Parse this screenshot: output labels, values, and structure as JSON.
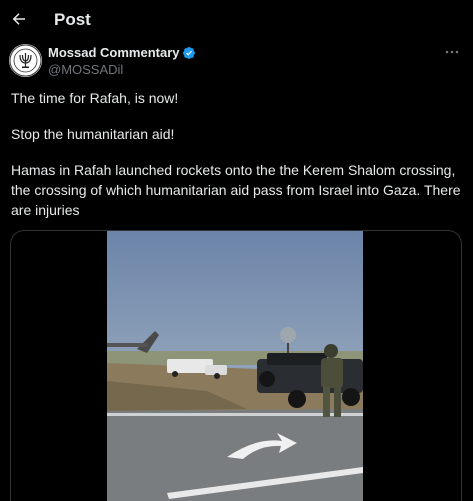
{
  "header": {
    "back_icon": "arrow-left-icon",
    "title": "Post"
  },
  "author": {
    "name": "Mossad Commentary",
    "handle": "@MOSSADil",
    "verified_icon": "verified-badge-icon",
    "verified_color": "#1d9bf0",
    "avatar_icon": "menorah-emblem-icon"
  },
  "more_icon": "more-horizontal-icon",
  "tweet": {
    "paragraphs": [
      "The time for Rafah, is now!",
      "Stop the humanitarian aid!",
      "Hamas in Rafah launched rockets onto the the Kerem Shalom crossing, the crossing of which humanitarian aid pass from Israel into Gaza. There are injuries"
    ]
  },
  "media": {
    "type": "video",
    "description_icon": "video-frame"
  },
  "colors": {
    "background": "#000000",
    "text": "#e7e9ea",
    "muted": "#71767b",
    "border": "#2f3336"
  }
}
